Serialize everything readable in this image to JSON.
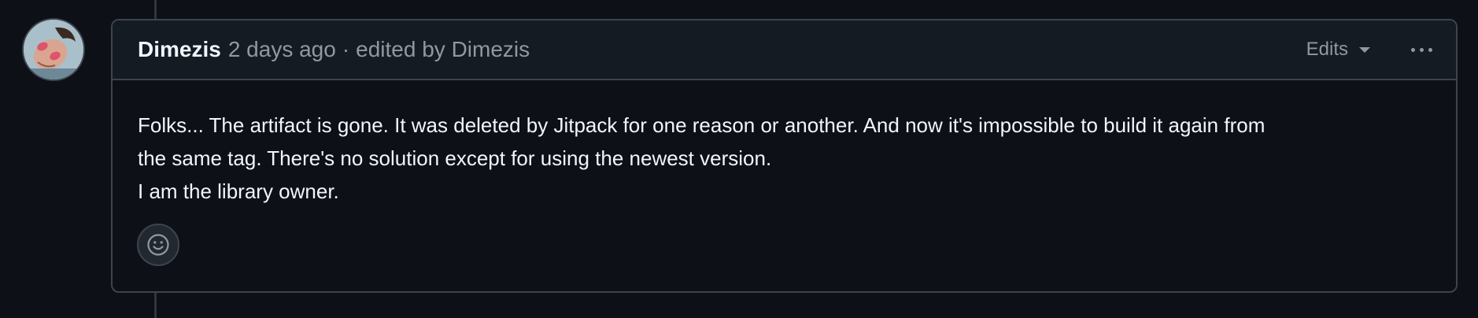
{
  "comment": {
    "author": "Dimezis",
    "timestamp": "2 days ago",
    "separator": "·",
    "edited_by": "edited by Dimezis",
    "edits_label": "Edits",
    "body": {
      "line1": "Folks... The artifact is gone. It was deleted by Jitpack for one reason or another. And now it's impossible to build it again from",
      "line2": "the same tag. There's no solution except for using the newest version.",
      "line3": "I am the library owner."
    }
  },
  "icons": {
    "avatar": "user-avatar",
    "edits_caret": "triangle-down-icon",
    "more": "kebab-horizontal-icon",
    "reaction": "smiley-icon"
  },
  "colors": {
    "background": "#0d1117",
    "header_bg": "#151b23",
    "border": "#3d444d",
    "text_primary": "#f0f6fc",
    "text_muted": "#9198a1"
  }
}
